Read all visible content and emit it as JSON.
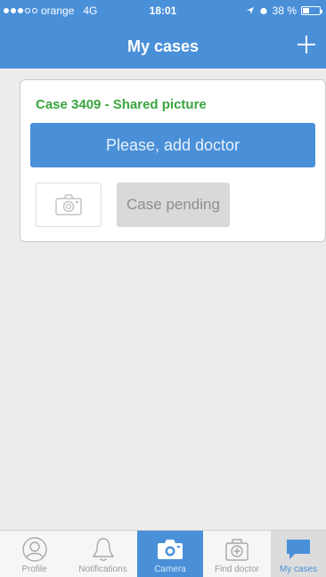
{
  "status_bar": {
    "carrier": "orange",
    "network": "4G",
    "time": "18:01",
    "battery": "38 %",
    "battery_level": 0.38
  },
  "nav": {
    "title": "My cases",
    "add_icon": "plus-icon"
  },
  "case": {
    "title": "Case 3409 - Shared picture",
    "add_doctor_label": "Please, add doctor",
    "camera_icon": "camera-icon",
    "status_label": "Case pending"
  },
  "tabs": [
    {
      "label": "Profile",
      "icon": "profile-icon"
    },
    {
      "label": "Notifications",
      "icon": "bell-icon"
    },
    {
      "label": "Camera",
      "icon": "camera-icon"
    },
    {
      "label": "Find doctor",
      "icon": "medical-kit-icon"
    },
    {
      "label": "My cases",
      "icon": "chat-bubble-icon"
    }
  ],
  "colors": {
    "accent": "#4a90d9",
    "case_title": "#3aa53f",
    "pending_bg": "#d9d9d9",
    "background": "#ececec"
  }
}
